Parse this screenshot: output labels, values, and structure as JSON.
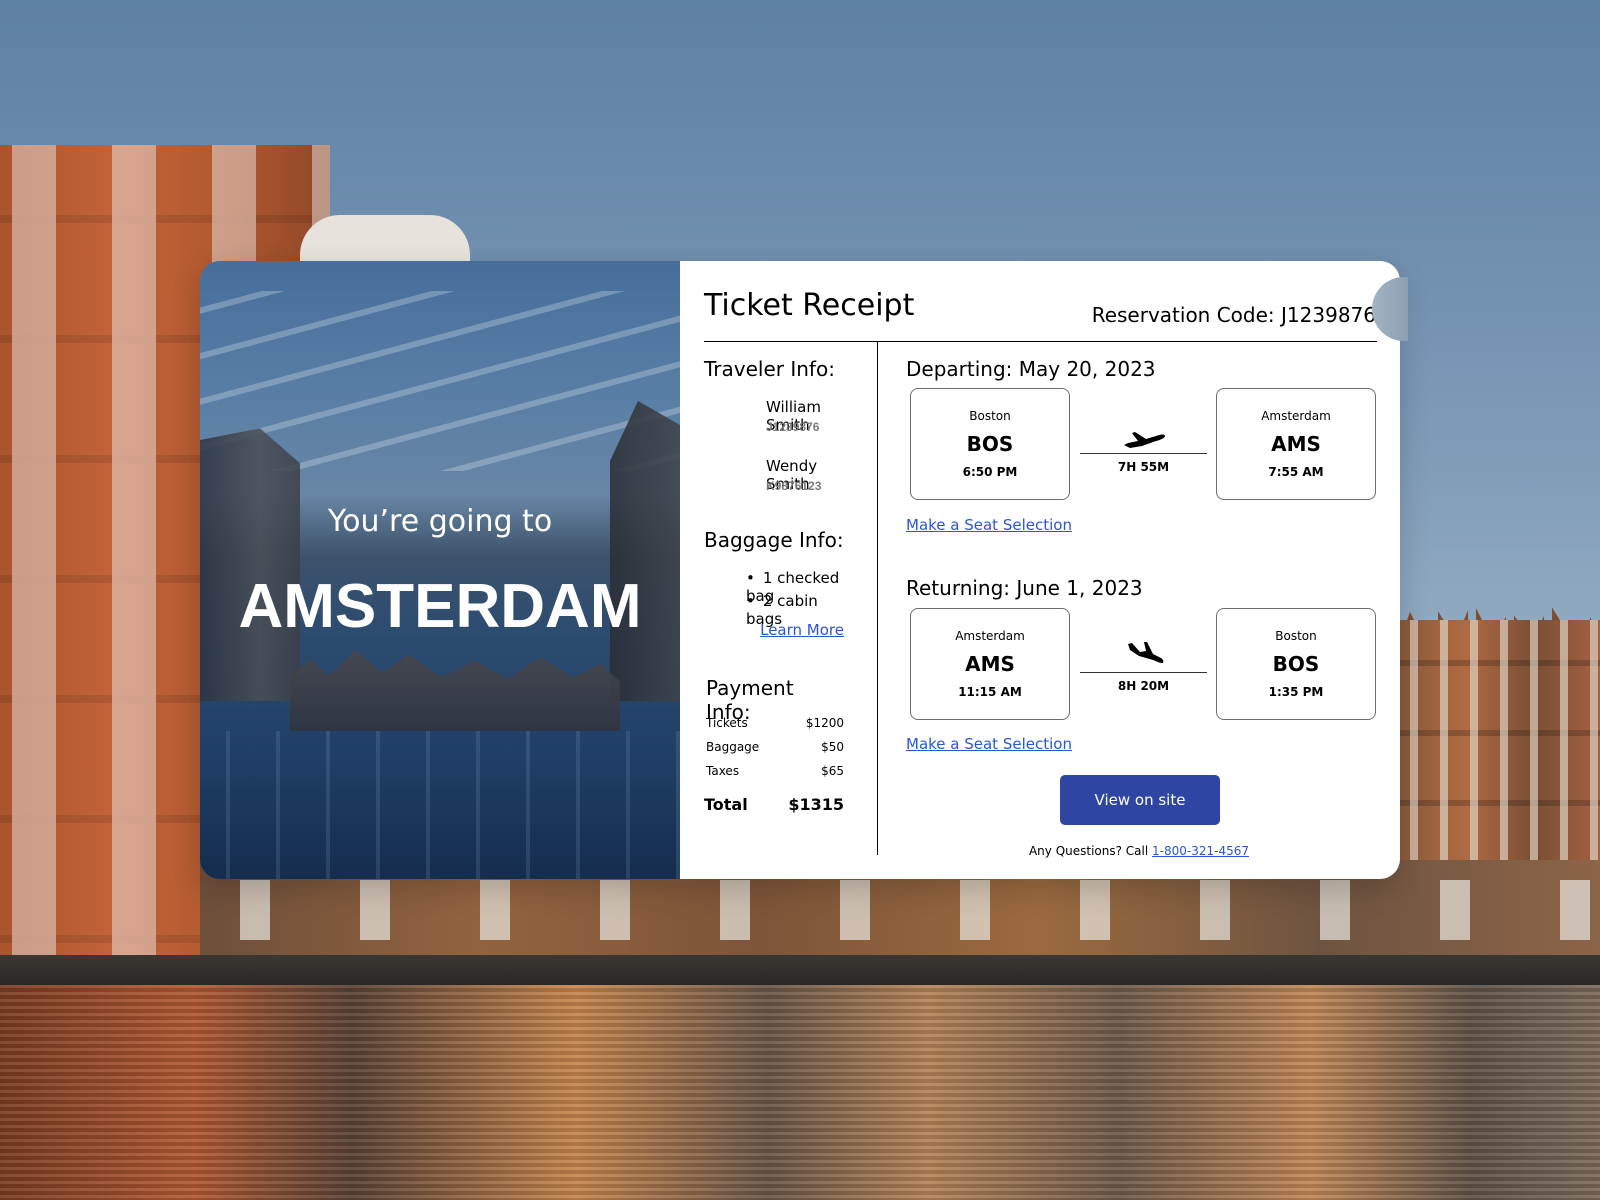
{
  "hero": {
    "subtitle": "You’re going to",
    "city": "AMSTERDAM"
  },
  "header": {
    "title": "Ticket Receipt",
    "reservation_label": "Reservation Code:",
    "reservation_code": "J1239876"
  },
  "traveler_info": {
    "heading": "Traveler Info:",
    "travelers": [
      {
        "name": "William Smith",
        "id": "J1239876"
      },
      {
        "name": "Wendy Smith",
        "id": "K9876123"
      }
    ]
  },
  "baggage_info": {
    "heading": "Baggage Info:",
    "items": [
      "1 checked bag",
      "2 cabin bags"
    ],
    "learn_more": "Learn More"
  },
  "payment_info": {
    "heading": "Payment Info:",
    "rows": [
      {
        "label": "Tickets",
        "amount": "$1200"
      },
      {
        "label": "Baggage",
        "amount": "$50"
      },
      {
        "label": "Taxes",
        "amount": "$65"
      }
    ],
    "total_label": "Total",
    "total_amount": "$1315"
  },
  "departing": {
    "heading": "Departing: May 20, 2023",
    "origin": {
      "city": "Boston",
      "code": "BOS",
      "time": "6:50 PM"
    },
    "destination": {
      "city": "Amsterdam",
      "code": "AMS",
      "time": "7:55 AM"
    },
    "duration": "7H 55M",
    "icon": "plane-takeoff-icon",
    "seat_link": "Make a Seat Selection"
  },
  "returning": {
    "heading": "Returning: June 1, 2023",
    "origin": {
      "city": "Amsterdam",
      "code": "AMS",
      "time": "11:15 AM"
    },
    "destination": {
      "city": "Boston",
      "code": "BOS",
      "time": "1:35 PM"
    },
    "duration": "8H 20M",
    "icon": "plane-landing-icon",
    "seat_link": "Make a Seat Selection"
  },
  "actions": {
    "view_on_site": "View on site"
  },
  "footer": {
    "question": "Any Questions? Call ",
    "phone": "1-800-321-4567"
  },
  "colors": {
    "primary_button": "#2e45a3",
    "link": "#2a55d6"
  }
}
